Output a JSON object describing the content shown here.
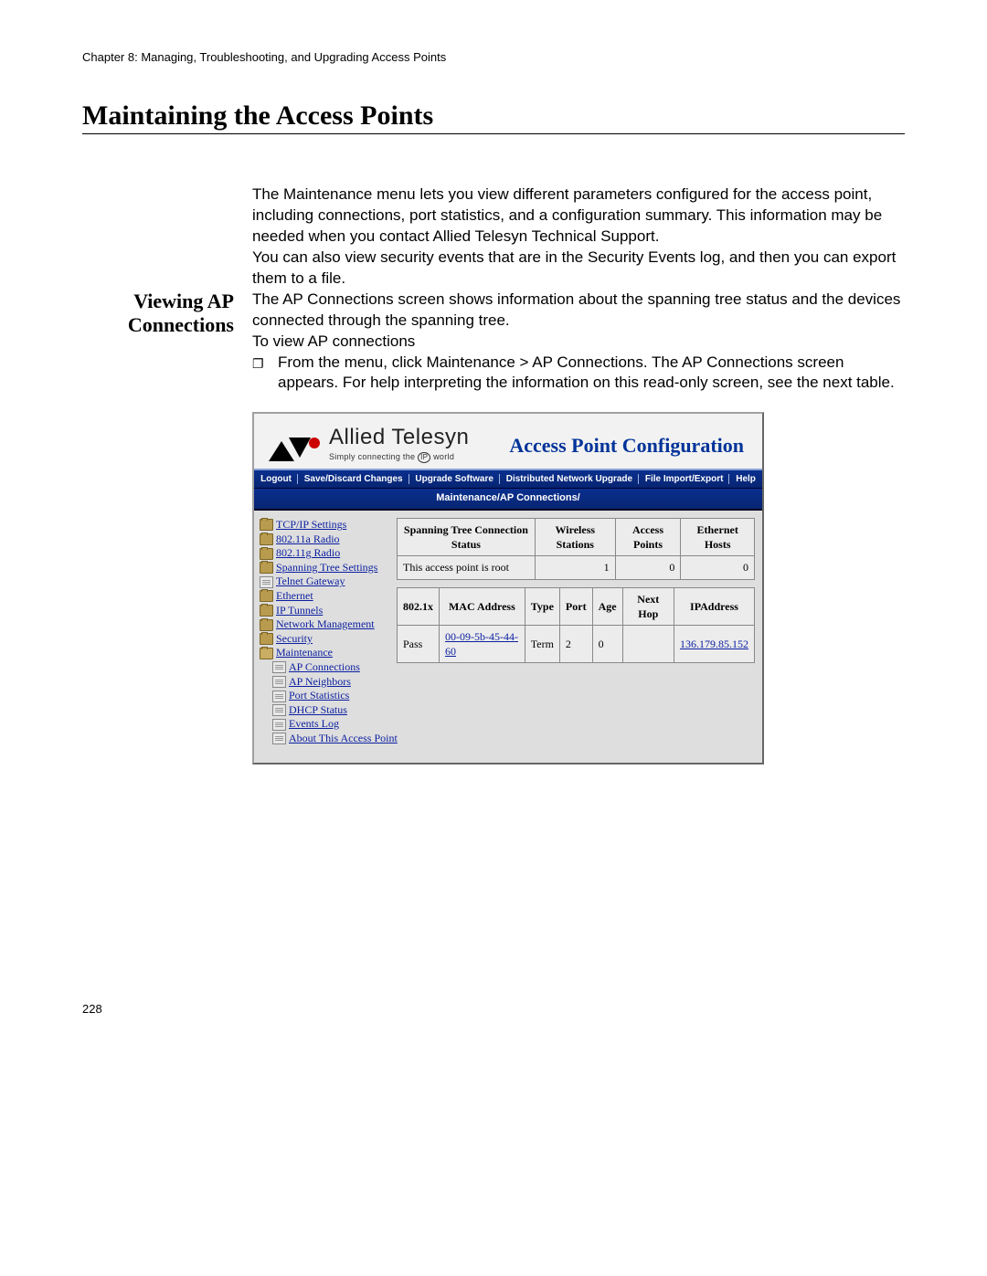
{
  "chapter_header": "Chapter 8: Managing, Troubleshooting, and Upgrading Access Points",
  "page_title": "Maintaining the Access Points",
  "intro_para1": "The Maintenance menu lets you view different parameters configured for the access point, including connections, port statistics, and a configuration summary. This information may be needed when you contact Allied Telesyn Technical Support.",
  "intro_para2": "You can also view security events that are in the Security Events log, and then you can export them to a file.",
  "section_heading_line1": "Viewing AP",
  "section_heading_line2": "Connections",
  "section_para1": "The AP Connections screen shows information about the spanning tree status and the devices connected through the spanning tree.",
  "section_para2": "To view AP connections",
  "bullet_text": "From the menu, click Maintenance > AP Connections. The AP Connections screen appears. For help interpreting the information on this read-only screen, see the next table.",
  "bullet_mark": "❐",
  "figure": {
    "logo_name": "Allied Telesyn",
    "logo_tagline_pre": "Simply connecting the ",
    "logo_tagline_ip": "IP",
    "logo_tagline_post": " world",
    "app_title": "Access Point Configuration",
    "menu": {
      "logout": "Logout",
      "save": "Save/Discard Changes",
      "upgrade": "Upgrade Software",
      "dist": "Distributed Network Upgrade",
      "file": "File Import/Export",
      "help": "Help"
    },
    "breadcrumb": "Maintenance/AP Connections/",
    "nav": {
      "tcpip": "TCP/IP Settings",
      "r11a": "802.11a Radio",
      "r11g": "802.11g Radio",
      "spanning": "Spanning Tree Settings",
      "telnet": "Telnet Gateway",
      "ethernet": "Ethernet",
      "iptunnels": "IP Tunnels",
      "netmgmt": "Network Management",
      "security": "Security",
      "maint": "Maintenance",
      "apconn": "AP Connections",
      "apneigh": "AP Neighbors",
      "portstat": "Port Statistics",
      "dhcp": "DHCP Status",
      "events": "Events Log",
      "about": "About This Access Point"
    },
    "table1": {
      "h_status": "Spanning Tree Connection Status",
      "h_wireless": "Wireless Stations",
      "h_ap": "Access Points",
      "h_eth": "Ethernet Hosts",
      "v_status": "This access point is root",
      "v_wireless": "1",
      "v_ap": "0",
      "v_eth": "0"
    },
    "table2": {
      "h_8021x": "802.1x",
      "h_mac": "MAC Address",
      "h_type": "Type",
      "h_port": "Port",
      "h_age": "Age",
      "h_next": "Next Hop",
      "h_ip": "IPAddress",
      "row": {
        "x": "Pass",
        "mac": "00-09-5b-45-44-60",
        "type": "Term",
        "port": "2",
        "age": "0",
        "next": "",
        "ip": "136.179.85.152"
      }
    }
  },
  "page_number": "228"
}
